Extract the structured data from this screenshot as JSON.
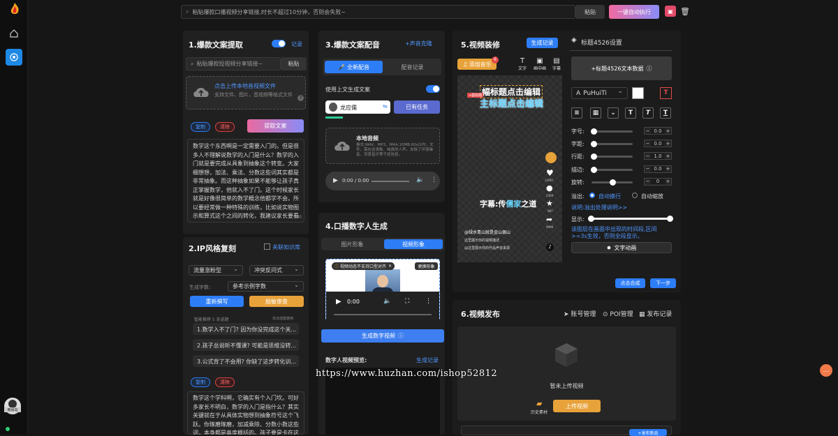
{
  "topbar": {
    "search_placeholder": "粘贴爆款口播视频分享链接,时长不超过10分钟，否则会失败~",
    "paste_label": "粘贴",
    "auto_run_label": "一键自动执行"
  },
  "user": {
    "name": "雨易站"
  },
  "panel1": {
    "title": "1.爆款文案提取",
    "record_label": "记录",
    "link_placeholder": "粘贴爆款短视频分享链接~",
    "paste_label": "粘贴",
    "upload_title": "点击上传本地音视频文件",
    "upload_desc": "支持文件、图片，音视频等格式文件",
    "copy_label": "复制",
    "clear_label": "清除",
    "extract_label": "提取文案",
    "text": "数学这个东西啊是一定需要入门的。但是很多人不理解说数学的入门是什么？数学的入门就是要完成从具象到抽象这个转变。大家细想想，加法、乘法、分数这些词其实都是非常抽象。而这种抽象如果不能够让孩子真正掌握数学，他就入不了门。这个时候家长就是好像很简单的数学概念他都学不会。所以要经常做一种特殊的训练，比如说实物图示和算式这个之间的转化，我建议家长要看看首页数学会里面有关算式、图式、文字、实物4种画面",
    "counter": "300"
  },
  "panel2": {
    "title": "2.IP风格复刻",
    "related_label": "关联知识库",
    "select_type": "流量涨粉型",
    "select_style": "冲突反问式",
    "word_count_label": "生成字数:",
    "word_count_value": "参考示例字数",
    "rewrite_label": "重新撰写",
    "review_label": "脱敏审查",
    "smart_rec": "智能推荐 5 条选题",
    "more_label": "非点选题使用",
    "topics": [
      "1.数学入不了门? 因为你没完成这个关...",
      "2.孩子总说听不懂课? 可能是思维没转...",
      "3.公式背了不会用? 你缺了这步转化训..."
    ],
    "copy_label": "复制",
    "clear_label": "清除",
    "text": "数学这个学科啊，它确实有个入门坎。可好多家长不明白，数学的入门是指什么？其实关键就在于从具体实物想到抽象符号这个飞跃。你琢磨琢磨，加减乘除、分数小数这些词，本身都是高度概括的。孩子要是卡在这个抽象关"
  },
  "panel3": {
    "title": "3.爆款文案配音",
    "clone_label": "+声音克隆",
    "tab_all": "全新配音",
    "tab_record": "配音记录",
    "use_above": "使用上文生成文案",
    "voice_name": "龙应儒",
    "has_task": "已有任务",
    "local_audio_title": "本地音频",
    "local_audio_desc": "格式:WAV、MP3、M4A,10MB,60s以内，文件，需包含清晰、纯真的人声，去除了环境噪音，背景音乐等干扰信息。",
    "audio_time": "0:00 / 0:00"
  },
  "panel4": {
    "title": "4.口播数字人生成",
    "tab_image": "图片形象",
    "tab_video": "视频形象",
    "notice": "视频动态不支持口型对齐",
    "change_label": "更换形象",
    "video_time": "0:00",
    "generate_label": "生成数字视频",
    "preview_label": "数字人视频预览:",
    "gen_record": "生成记录"
  },
  "panel5": {
    "title": "5.视频装修",
    "gen_record": "生成记录",
    "music_label": "添加音乐",
    "music_badge": "6",
    "tools": [
      "文字",
      "画中画",
      "字幕"
    ],
    "title_top": "幅标题点击编辑",
    "title_main": "主标题点击编辑",
    "badge_subtitle": "+副标题",
    "subtitle_pre": "字幕:传",
    "subtitle_hi": "儒家",
    "subtitle_post": "之道",
    "likes": "12967",
    "comments": "2369",
    "stars": "987",
    "shares": "9999",
    "author": "@绿水青山就是金山银山",
    "desc1": "这里展示你的视频描述",
    "desc2": "@这里展示你的作品声音来源",
    "synth_label": "点击合成",
    "next_label": "下一步"
  },
  "settings": {
    "title": "标题4526设置",
    "add_text": "+标题4526文本数据",
    "font": "PuHuiTi",
    "rows": [
      {
        "label": "字号:",
        "value": "0.0",
        "pos": 0.05
      },
      {
        "label": "字距:",
        "value": "0.0",
        "pos": 0.05
      },
      {
        "label": "行距:",
        "value": "1.0",
        "pos": 0.05
      },
      {
        "label": "描边:",
        "value": "0.0",
        "pos": 0.05
      },
      {
        "label": "旋转:",
        "value": "0",
        "pos": 0.5
      }
    ],
    "overflow_label": "溢出:",
    "opt_wrap": "自动换行",
    "opt_scale": "自动缩放",
    "overflow_link": "说明:溢出处理说明>>",
    "display_label": "显示:",
    "display_desc": "该图层在画面中出现的时间段,区间>=3s生效，否则全段显示。",
    "anim_label": "文字动画"
  },
  "panel6": {
    "title": "6.视频发布",
    "account": "账号管理",
    "poi": "POI管理",
    "publish_record": "发布记录",
    "empty": "暂未上传视频",
    "history": "历史素材",
    "upload_label": "上传视频",
    "publish_label": "+发布新品"
  },
  "watermark": "https://www.huzhan.com/ishop52812",
  "colors": {
    "accent": "#2d7df6",
    "orange": "#e8a23a",
    "danger": "#d64545"
  }
}
